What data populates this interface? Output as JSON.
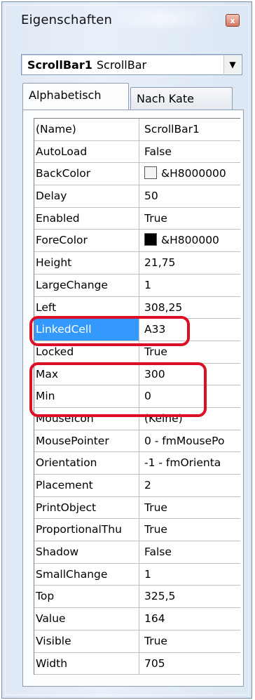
{
  "window": {
    "title": "Eigenschaften",
    "close_symbol": "x"
  },
  "object_select": {
    "name": "ScrollBar1",
    "type": "ScrollBar"
  },
  "tabs": {
    "alphabetical": "Alphabetisch",
    "category": "Nach Kate"
  },
  "properties": [
    {
      "name": "(Name)",
      "value": "ScrollBar1"
    },
    {
      "name": "AutoLoad",
      "value": "False"
    },
    {
      "name": "BackColor",
      "value": "&H8000000",
      "swatch": "light"
    },
    {
      "name": "Delay",
      "value": "50"
    },
    {
      "name": "Enabled",
      "value": "True"
    },
    {
      "name": "ForeColor",
      "value": "&H800000",
      "swatch": "dark"
    },
    {
      "name": "Height",
      "value": "21,75"
    },
    {
      "name": "LargeChange",
      "value": "1"
    },
    {
      "name": "Left",
      "value": "308,25"
    },
    {
      "name": "LinkedCell",
      "value": "A33",
      "selected": true
    },
    {
      "name": "Locked",
      "value": "True"
    },
    {
      "name": "Max",
      "value": "300"
    },
    {
      "name": "Min",
      "value": "0"
    },
    {
      "name": "MouseIcon",
      "value": "(Keine)"
    },
    {
      "name": "MousePointer",
      "value": "0 - fmMousePo"
    },
    {
      "name": "Orientation",
      "value": "-1 - fmOrienta"
    },
    {
      "name": "Placement",
      "value": "2"
    },
    {
      "name": "PrintObject",
      "value": "True"
    },
    {
      "name": "ProportionalThu",
      "value": "True"
    },
    {
      "name": "Shadow",
      "value": "False"
    },
    {
      "name": "SmallChange",
      "value": "1"
    },
    {
      "name": "Top",
      "value": "325,5"
    },
    {
      "name": "Value",
      "value": "164"
    },
    {
      "name": "Visible",
      "value": "True"
    },
    {
      "name": "Width",
      "value": "705"
    }
  ],
  "colors": {
    "selection": "#3399ff",
    "highlight_annotation": "#dd0f26",
    "window_frame": "#dfe9f5"
  }
}
